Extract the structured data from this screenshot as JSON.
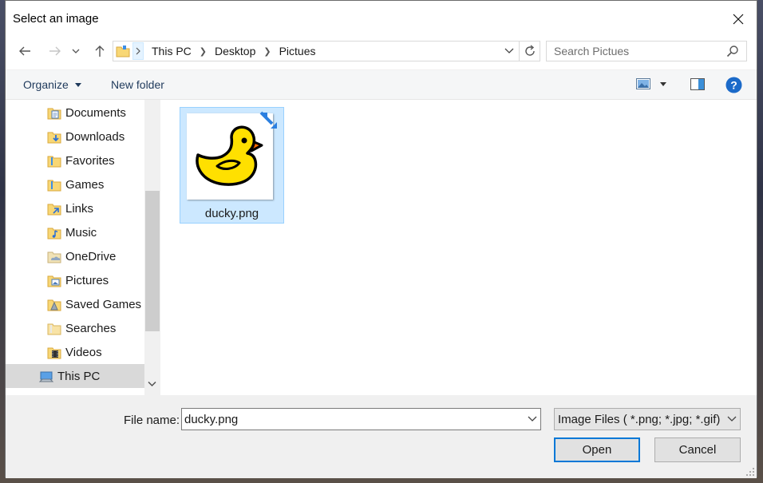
{
  "window": {
    "title": "Select an image"
  },
  "nav": {
    "breadcrumbs": [
      "This PC",
      "Desktop",
      "Pictues"
    ],
    "search_placeholder": "Search Pictues"
  },
  "toolbar": {
    "organize_label": "Organize",
    "new_folder_label": "New folder"
  },
  "sidebar": {
    "items": [
      {
        "label": "Documents",
        "icon": "documents-folder-icon"
      },
      {
        "label": "Downloads",
        "icon": "downloads-folder-icon"
      },
      {
        "label": "Favorites",
        "icon": "favorites-folder-icon"
      },
      {
        "label": "Games",
        "icon": "games-folder-icon"
      },
      {
        "label": "Links",
        "icon": "links-folder-icon"
      },
      {
        "label": "Music",
        "icon": "music-folder-icon"
      },
      {
        "label": "OneDrive",
        "icon": "onedrive-folder-icon"
      },
      {
        "label": "Pictures",
        "icon": "pictures-folder-icon"
      },
      {
        "label": "Saved Games",
        "icon": "saved-games-folder-icon"
      },
      {
        "label": "Searches",
        "icon": "searches-folder-icon"
      },
      {
        "label": "Videos",
        "icon": "videos-folder-icon"
      },
      {
        "label": "This PC",
        "icon": "computer-icon",
        "selected": true
      }
    ]
  },
  "files": [
    {
      "name": "ducky.png",
      "selected": true,
      "icon": "duck-thumbnail"
    }
  ],
  "footer": {
    "file_name_label": "File name:",
    "file_name_value": "ducky.png",
    "file_type": "Image Files ( *.png; *.jpg; *.gif)",
    "open_label": "Open",
    "cancel_label": "Cancel"
  },
  "colors": {
    "selection": "#cce8ff",
    "selection_border": "#99d1ff",
    "accent": "#0078d7",
    "duck_yellow": "#ffe000",
    "duck_beak": "#ff6a00"
  }
}
